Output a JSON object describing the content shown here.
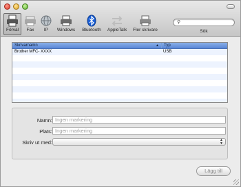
{
  "toolbar": {
    "items": [
      {
        "label": "Förval",
        "icon": "printer-default-icon"
      },
      {
        "label": "Fax",
        "icon": "fax-icon"
      },
      {
        "label": "IP",
        "icon": "globe-ip-icon"
      },
      {
        "label": "Windows",
        "icon": "windows-printer-icon"
      },
      {
        "label": "Bluetooth",
        "icon": "bluetooth-icon"
      },
      {
        "label": "AppleTalk",
        "icon": "appletalk-icon"
      },
      {
        "label": "Fler skrivare",
        "icon": "more-printers-icon"
      }
    ],
    "search_label": "Sök"
  },
  "list": {
    "columns": {
      "name": "Skrivarnamn",
      "type": "Typ"
    },
    "rows": [
      {
        "name": "Brother MFC- XXXX",
        "type": "USB"
      }
    ]
  },
  "form": {
    "name_label": "Namn:",
    "name_value": "Ingen markering",
    "place_label": "Plats:",
    "place_value": "Ingen markering",
    "print_with_label": "Skriv ut med:"
  },
  "buttons": {
    "add": "Lägg till"
  },
  "colors": {
    "selection_blue": "#5a86d6",
    "bluetooth": "#1a5fd6"
  }
}
